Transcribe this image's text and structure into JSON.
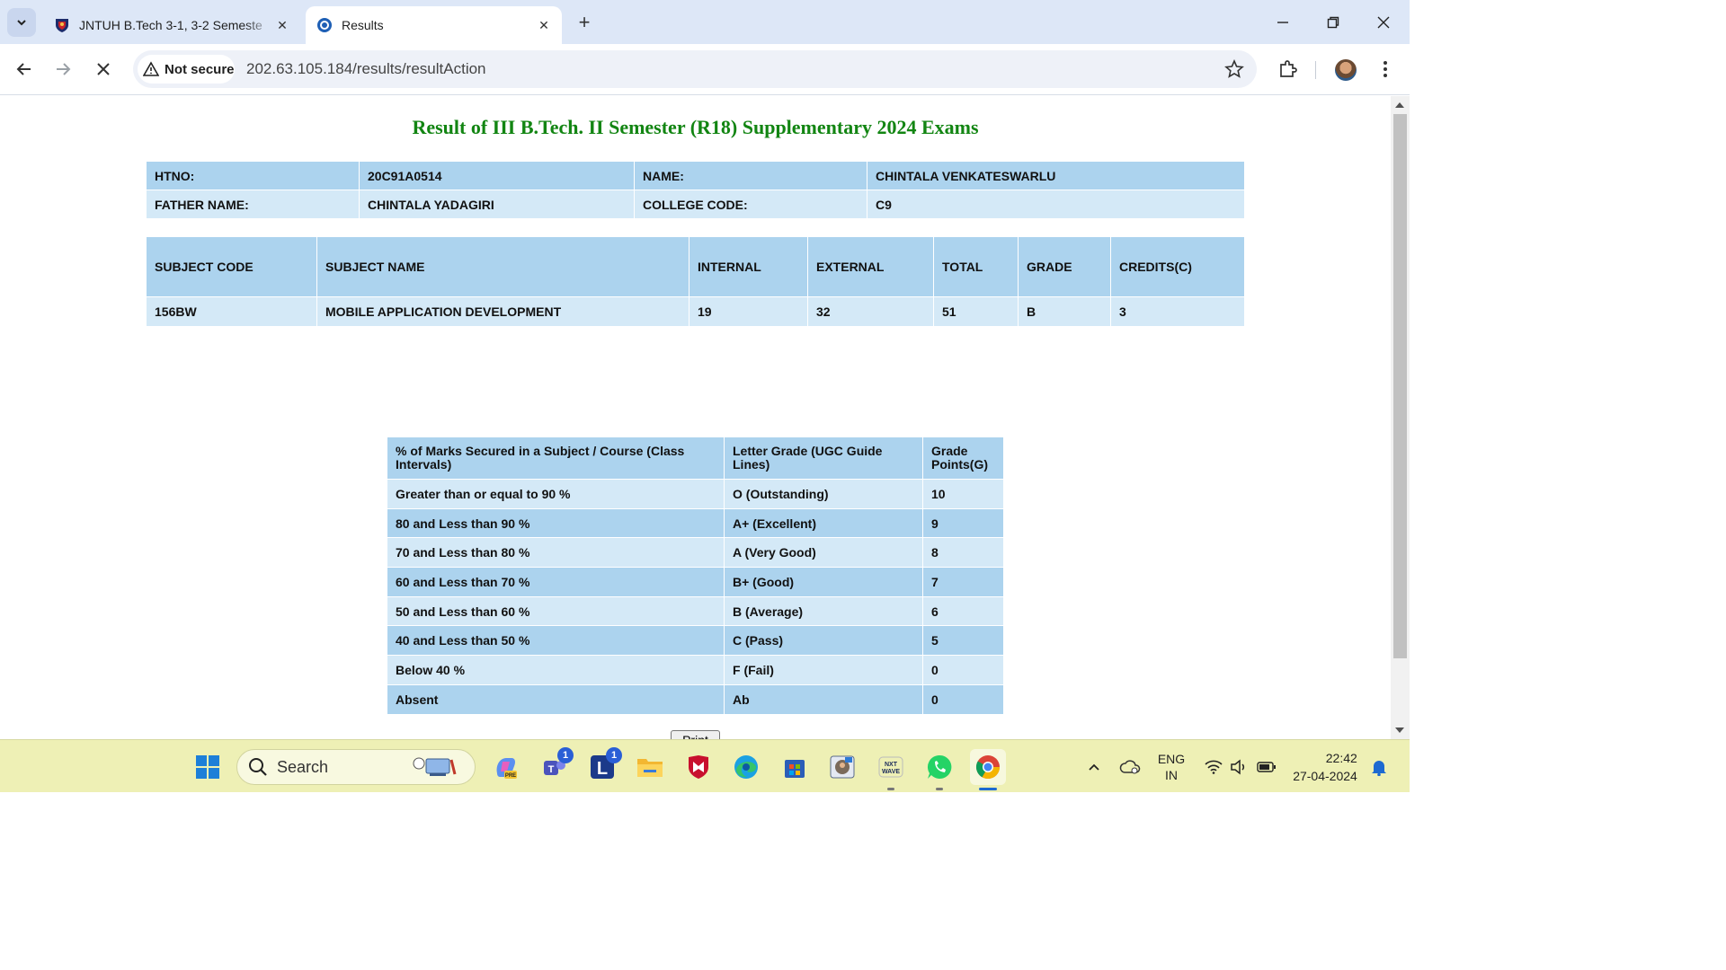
{
  "browser": {
    "tabs": [
      {
        "title": "JNTUH B.Tech 3-1, 3-2 Semeste",
        "active": false
      },
      {
        "title": "Results",
        "active": true
      }
    ],
    "security_label": "Not secure",
    "url": "202.63.105.184/results/resultAction"
  },
  "page": {
    "title": "Result of III B.Tech. II Semester (R18) Supplementary 2024 Exams",
    "student": {
      "htno_label": "HTNO:",
      "htno": "20C91A0514",
      "name_label": "NAME:",
      "name": "CHINTALA VENKATESWARLU",
      "father_label": "FATHER NAME:",
      "father": "CHINTALA YADAGIRI",
      "college_label": "COLLEGE CODE:",
      "college": "C9"
    },
    "marks_headers": [
      "SUBJECT CODE",
      "SUBJECT NAME",
      "INTERNAL",
      "EXTERNAL",
      "TOTAL",
      "GRADE",
      "CREDITS(C)"
    ],
    "marks_rows": [
      [
        "156BW",
        "MOBILE APPLICATION DEVELOPMENT",
        "19",
        "32",
        "51",
        "B",
        "3"
      ]
    ],
    "grade_headers": [
      "% of Marks Secured in a Subject / Course (Class Intervals)",
      "Letter Grade (UGC Guide Lines)",
      "Grade Points(G)"
    ],
    "grade_rows": [
      [
        "Greater than or equal to 90 %",
        "O (Outstanding)",
        "10"
      ],
      [
        "80 and Less than 90 %",
        "A+ (Excellent)",
        "9"
      ],
      [
        "70 and Less than 80 %",
        "A (Very Good)",
        "8"
      ],
      [
        "60 and Less than 70 %",
        "B+ (Good)",
        "7"
      ],
      [
        "50 and Less than 60 %",
        "B (Average)",
        "6"
      ],
      [
        "40 and Less than 50 %",
        "C (Pass)",
        "5"
      ],
      [
        "Below 40 %",
        "F (Fail)",
        "0"
      ],
      [
        "Absent",
        "Ab",
        "0"
      ]
    ],
    "print_label": "Print"
  },
  "taskbar": {
    "search_placeholder": "Search",
    "teams_badge": "1",
    "l_badge": "1",
    "lang_top": "ENG",
    "lang_bottom": "IN",
    "time": "22:42",
    "date": "27-04-2024"
  },
  "colors": {
    "title_green": "#128512",
    "row_dark": "#acd3ee",
    "row_light": "#d4e9f7"
  }
}
